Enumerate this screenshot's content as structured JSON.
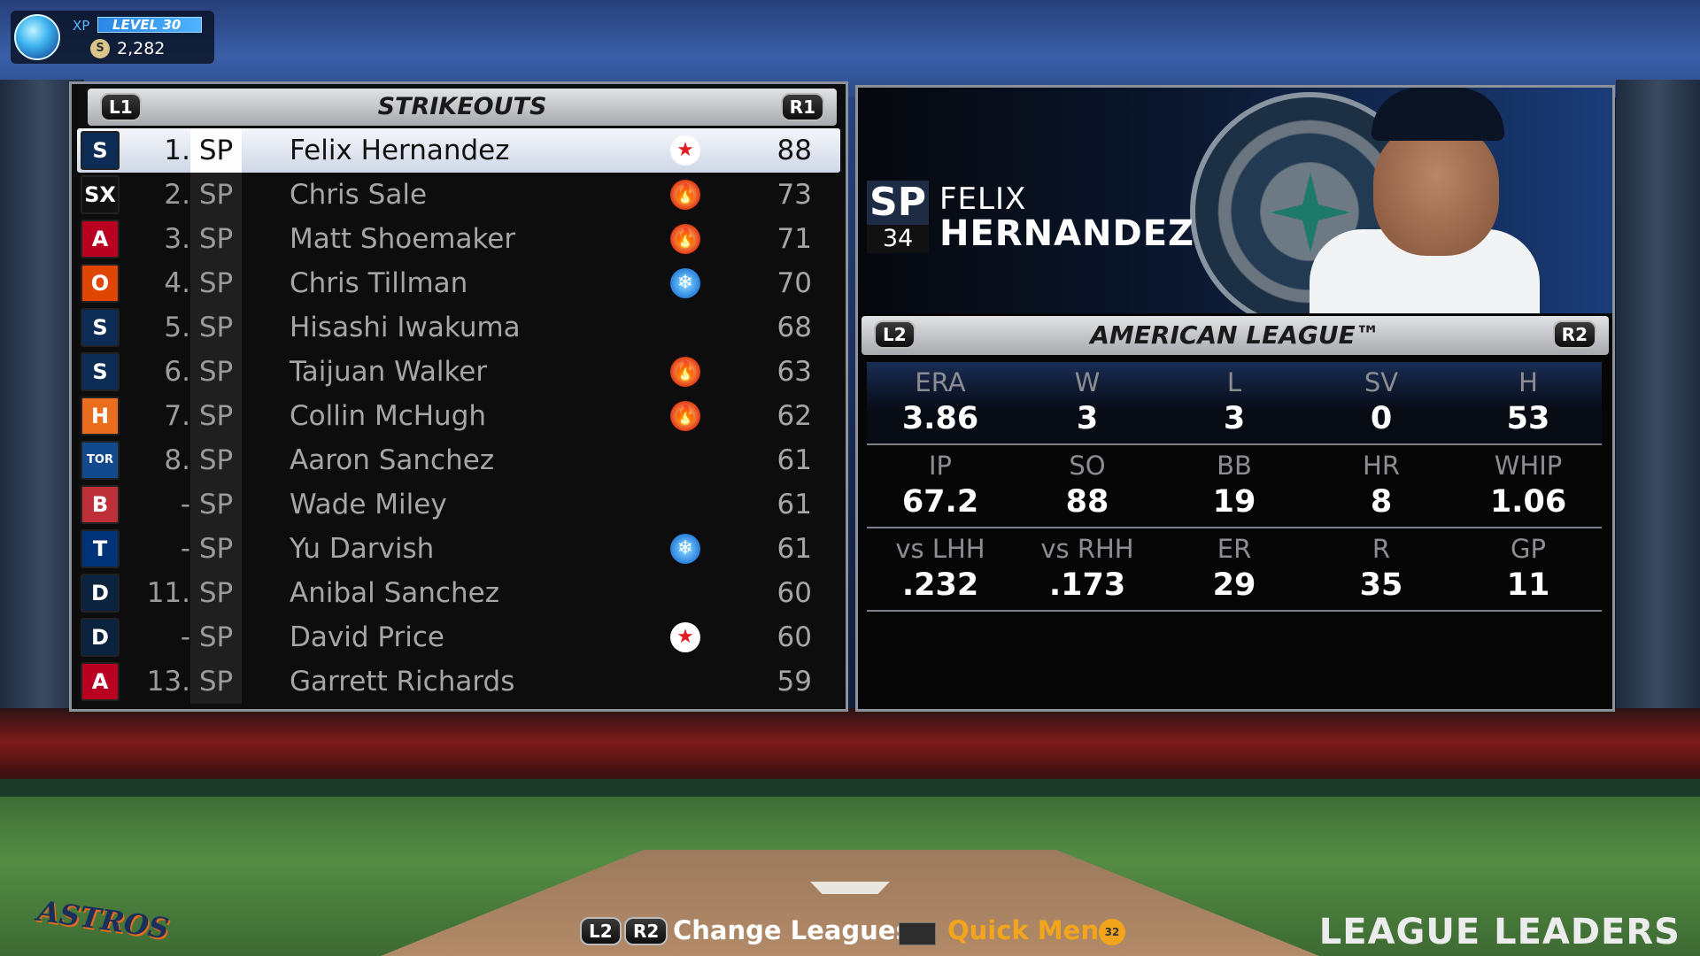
{
  "hud": {
    "xp_label": "XP",
    "level_text": "LEVEL 30",
    "coin_symbol": "S",
    "coins": "2,282"
  },
  "leaderboard": {
    "title": "STRIKEOUTS",
    "prev_button": "L1",
    "next_button": "R1",
    "rows": [
      {
        "logo": "S",
        "logo_color": "#0c2c56",
        "rank": "1.",
        "pos": "SP",
        "name": "Felix Hernandez",
        "icon": "star",
        "value": "88",
        "selected": true
      },
      {
        "logo": "SX",
        "logo_color": "#111111",
        "rank": "2.",
        "pos": "SP",
        "name": "Chris Sale",
        "icon": "hot",
        "value": "73"
      },
      {
        "logo": "A",
        "logo_color": "#ba0021",
        "rank": "3.",
        "pos": "SP",
        "name": "Matt Shoemaker",
        "icon": "hot",
        "value": "71"
      },
      {
        "logo": "O",
        "logo_color": "#df4601",
        "rank": "4.",
        "pos": "SP",
        "name": "Chris Tillman",
        "icon": "cold",
        "value": "70"
      },
      {
        "logo": "S",
        "logo_color": "#0c2c56",
        "rank": "5.",
        "pos": "SP",
        "name": "Hisashi Iwakuma",
        "icon": "",
        "value": "68"
      },
      {
        "logo": "S",
        "logo_color": "#0c2c56",
        "rank": "6.",
        "pos": "SP",
        "name": "Taijuan Walker",
        "icon": "hot",
        "value": "63"
      },
      {
        "logo": "H",
        "logo_color": "#eb6e1f",
        "rank": "7.",
        "pos": "SP",
        "name": "Collin McHugh",
        "icon": "hot",
        "value": "62"
      },
      {
        "logo": "TOR",
        "logo_color": "#134a8e",
        "rank": "8.",
        "pos": "SP",
        "name": "Aaron Sanchez",
        "icon": "",
        "value": "61"
      },
      {
        "logo": "B",
        "logo_color": "#bd3039",
        "rank": "-",
        "pos": "SP",
        "name": "Wade Miley",
        "icon": "",
        "value": "61"
      },
      {
        "logo": "T",
        "logo_color": "#003278",
        "rank": "-",
        "pos": "SP",
        "name": "Yu Darvish",
        "icon": "cold",
        "value": "61"
      },
      {
        "logo": "D",
        "logo_color": "#0c2340",
        "rank": "11.",
        "pos": "SP",
        "name": "Anibal Sanchez",
        "icon": "",
        "value": "60"
      },
      {
        "logo": "D",
        "logo_color": "#0c2340",
        "rank": "-",
        "pos": "SP",
        "name": "David Price",
        "icon": "star",
        "value": "60"
      },
      {
        "logo": "A",
        "logo_color": "#ba0021",
        "rank": "13.",
        "pos": "SP",
        "name": "Garrett Richards",
        "icon": "",
        "value": "59"
      }
    ]
  },
  "player": {
    "position": "SP",
    "number": "34",
    "first_name": "FELIX",
    "last_name": "HERNANDEZ"
  },
  "league": {
    "title": "AMERICAN LEAGUE™",
    "prev_button": "L2",
    "next_button": "R2"
  },
  "stats": [
    [
      {
        "label": "ERA",
        "value": "3.86"
      },
      {
        "label": "W",
        "value": "3"
      },
      {
        "label": "L",
        "value": "3"
      },
      {
        "label": "SV",
        "value": "0"
      },
      {
        "label": "H",
        "value": "53"
      }
    ],
    [
      {
        "label": "IP",
        "value": "67.2"
      },
      {
        "label": "SO",
        "value": "88"
      },
      {
        "label": "BB",
        "value": "19"
      },
      {
        "label": "HR",
        "value": "8"
      },
      {
        "label": "WHIP",
        "value": "1.06"
      }
    ],
    [
      {
        "label": "vs LHH",
        "value": ".232"
      },
      {
        "label": "vs RHH",
        "value": ".173"
      },
      {
        "label": "ER",
        "value": "29"
      },
      {
        "label": "R",
        "value": "35"
      },
      {
        "label": "GP",
        "value": "11"
      }
    ]
  ],
  "footer": {
    "l2": "L2",
    "r2": "R2",
    "change_leagues": "Change Leagues",
    "quick_menu": "Quick Menu",
    "quick_badge": "32",
    "screen_title": "LEAGUE LEADERS",
    "team_wordmark": "ASTROS"
  },
  "icons": {
    "star": "★",
    "hot": "🔥",
    "cold": "❄"
  }
}
